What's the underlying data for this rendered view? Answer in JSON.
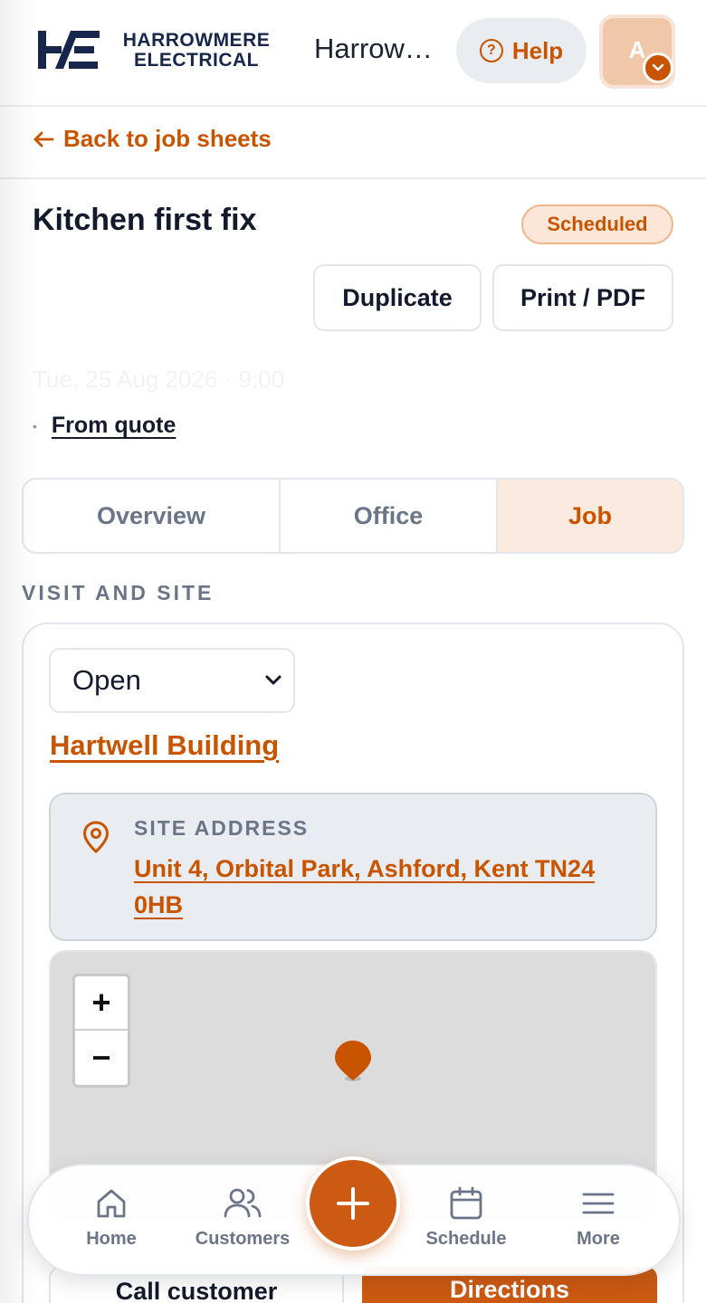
{
  "header": {
    "logo_line1": "HARROWMERE",
    "logo_line2": "ELECTRICAL",
    "company_name": "Harrowmere Electrical",
    "help_label": "Help",
    "avatar_initial": "A"
  },
  "nav": {
    "back_label": "Back to job sheets"
  },
  "job": {
    "title": "Kitchen first fix",
    "status": "Scheduled",
    "duplicate_label": "Duplicate",
    "print_label": "Print / PDF",
    "date_line": "Tue, 25 Aug 2026 · 9:00",
    "source_link": "From quote"
  },
  "tabs": [
    {
      "label": "Overview",
      "active": false
    },
    {
      "label": "Office",
      "active": false
    },
    {
      "label": "Job",
      "active": true
    }
  ],
  "visit": {
    "section_title": "VISIT AND SITE",
    "status_select": "Open",
    "customer_name": "Hartwell Building",
    "site_address_label": "SITE ADDRESS",
    "site_address": "Unit 4, Orbital Park, Ashford, Kent TN24 0HB",
    "zoom_in": "+",
    "zoom_out": "−",
    "call_label": "Call customer",
    "directions_label": "Directions"
  },
  "bottom_nav": {
    "home": "Home",
    "customers": "Customers",
    "schedule": "Schedule",
    "more": "More"
  },
  "colors": {
    "accent": "#c95400",
    "navy": "#17264a",
    "muted": "#6b7587"
  }
}
